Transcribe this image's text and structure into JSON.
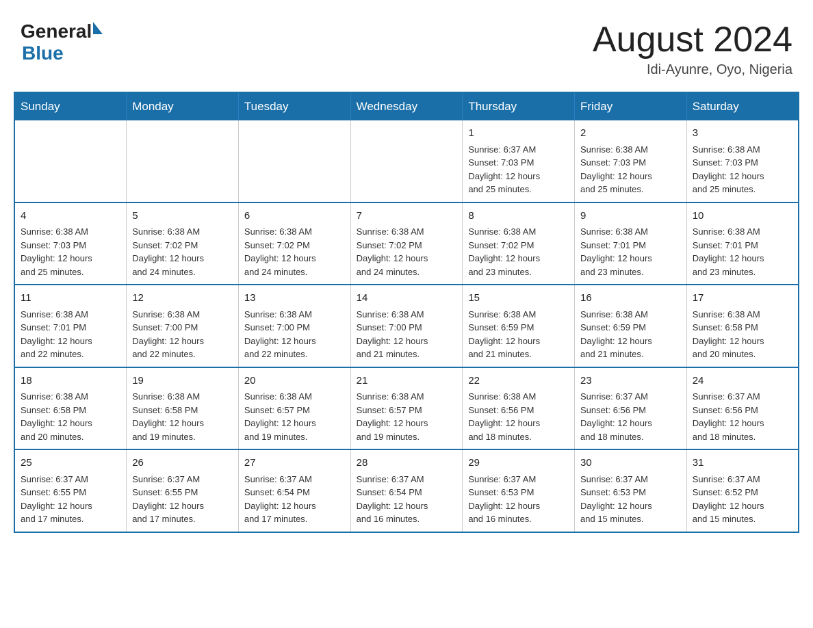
{
  "header": {
    "logo_general": "General",
    "logo_blue": "Blue",
    "month_title": "August 2024",
    "location": "Idi-Ayunre, Oyo, Nigeria"
  },
  "days_of_week": [
    "Sunday",
    "Monday",
    "Tuesday",
    "Wednesday",
    "Thursday",
    "Friday",
    "Saturday"
  ],
  "weeks": [
    [
      {
        "day": "",
        "info": ""
      },
      {
        "day": "",
        "info": ""
      },
      {
        "day": "",
        "info": ""
      },
      {
        "day": "",
        "info": ""
      },
      {
        "day": "1",
        "info": "Sunrise: 6:37 AM\nSunset: 7:03 PM\nDaylight: 12 hours\nand 25 minutes."
      },
      {
        "day": "2",
        "info": "Sunrise: 6:38 AM\nSunset: 7:03 PM\nDaylight: 12 hours\nand 25 minutes."
      },
      {
        "day": "3",
        "info": "Sunrise: 6:38 AM\nSunset: 7:03 PM\nDaylight: 12 hours\nand 25 minutes."
      }
    ],
    [
      {
        "day": "4",
        "info": "Sunrise: 6:38 AM\nSunset: 7:03 PM\nDaylight: 12 hours\nand 25 minutes."
      },
      {
        "day": "5",
        "info": "Sunrise: 6:38 AM\nSunset: 7:02 PM\nDaylight: 12 hours\nand 24 minutes."
      },
      {
        "day": "6",
        "info": "Sunrise: 6:38 AM\nSunset: 7:02 PM\nDaylight: 12 hours\nand 24 minutes."
      },
      {
        "day": "7",
        "info": "Sunrise: 6:38 AM\nSunset: 7:02 PM\nDaylight: 12 hours\nand 24 minutes."
      },
      {
        "day": "8",
        "info": "Sunrise: 6:38 AM\nSunset: 7:02 PM\nDaylight: 12 hours\nand 23 minutes."
      },
      {
        "day": "9",
        "info": "Sunrise: 6:38 AM\nSunset: 7:01 PM\nDaylight: 12 hours\nand 23 minutes."
      },
      {
        "day": "10",
        "info": "Sunrise: 6:38 AM\nSunset: 7:01 PM\nDaylight: 12 hours\nand 23 minutes."
      }
    ],
    [
      {
        "day": "11",
        "info": "Sunrise: 6:38 AM\nSunset: 7:01 PM\nDaylight: 12 hours\nand 22 minutes."
      },
      {
        "day": "12",
        "info": "Sunrise: 6:38 AM\nSunset: 7:00 PM\nDaylight: 12 hours\nand 22 minutes."
      },
      {
        "day": "13",
        "info": "Sunrise: 6:38 AM\nSunset: 7:00 PM\nDaylight: 12 hours\nand 22 minutes."
      },
      {
        "day": "14",
        "info": "Sunrise: 6:38 AM\nSunset: 7:00 PM\nDaylight: 12 hours\nand 21 minutes."
      },
      {
        "day": "15",
        "info": "Sunrise: 6:38 AM\nSunset: 6:59 PM\nDaylight: 12 hours\nand 21 minutes."
      },
      {
        "day": "16",
        "info": "Sunrise: 6:38 AM\nSunset: 6:59 PM\nDaylight: 12 hours\nand 21 minutes."
      },
      {
        "day": "17",
        "info": "Sunrise: 6:38 AM\nSunset: 6:58 PM\nDaylight: 12 hours\nand 20 minutes."
      }
    ],
    [
      {
        "day": "18",
        "info": "Sunrise: 6:38 AM\nSunset: 6:58 PM\nDaylight: 12 hours\nand 20 minutes."
      },
      {
        "day": "19",
        "info": "Sunrise: 6:38 AM\nSunset: 6:58 PM\nDaylight: 12 hours\nand 19 minutes."
      },
      {
        "day": "20",
        "info": "Sunrise: 6:38 AM\nSunset: 6:57 PM\nDaylight: 12 hours\nand 19 minutes."
      },
      {
        "day": "21",
        "info": "Sunrise: 6:38 AM\nSunset: 6:57 PM\nDaylight: 12 hours\nand 19 minutes."
      },
      {
        "day": "22",
        "info": "Sunrise: 6:38 AM\nSunset: 6:56 PM\nDaylight: 12 hours\nand 18 minutes."
      },
      {
        "day": "23",
        "info": "Sunrise: 6:37 AM\nSunset: 6:56 PM\nDaylight: 12 hours\nand 18 minutes."
      },
      {
        "day": "24",
        "info": "Sunrise: 6:37 AM\nSunset: 6:56 PM\nDaylight: 12 hours\nand 18 minutes."
      }
    ],
    [
      {
        "day": "25",
        "info": "Sunrise: 6:37 AM\nSunset: 6:55 PM\nDaylight: 12 hours\nand 17 minutes."
      },
      {
        "day": "26",
        "info": "Sunrise: 6:37 AM\nSunset: 6:55 PM\nDaylight: 12 hours\nand 17 minutes."
      },
      {
        "day": "27",
        "info": "Sunrise: 6:37 AM\nSunset: 6:54 PM\nDaylight: 12 hours\nand 17 minutes."
      },
      {
        "day": "28",
        "info": "Sunrise: 6:37 AM\nSunset: 6:54 PM\nDaylight: 12 hours\nand 16 minutes."
      },
      {
        "day": "29",
        "info": "Sunrise: 6:37 AM\nSunset: 6:53 PM\nDaylight: 12 hours\nand 16 minutes."
      },
      {
        "day": "30",
        "info": "Sunrise: 6:37 AM\nSunset: 6:53 PM\nDaylight: 12 hours\nand 15 minutes."
      },
      {
        "day": "31",
        "info": "Sunrise: 6:37 AM\nSunset: 6:52 PM\nDaylight: 12 hours\nand 15 minutes."
      }
    ]
  ]
}
